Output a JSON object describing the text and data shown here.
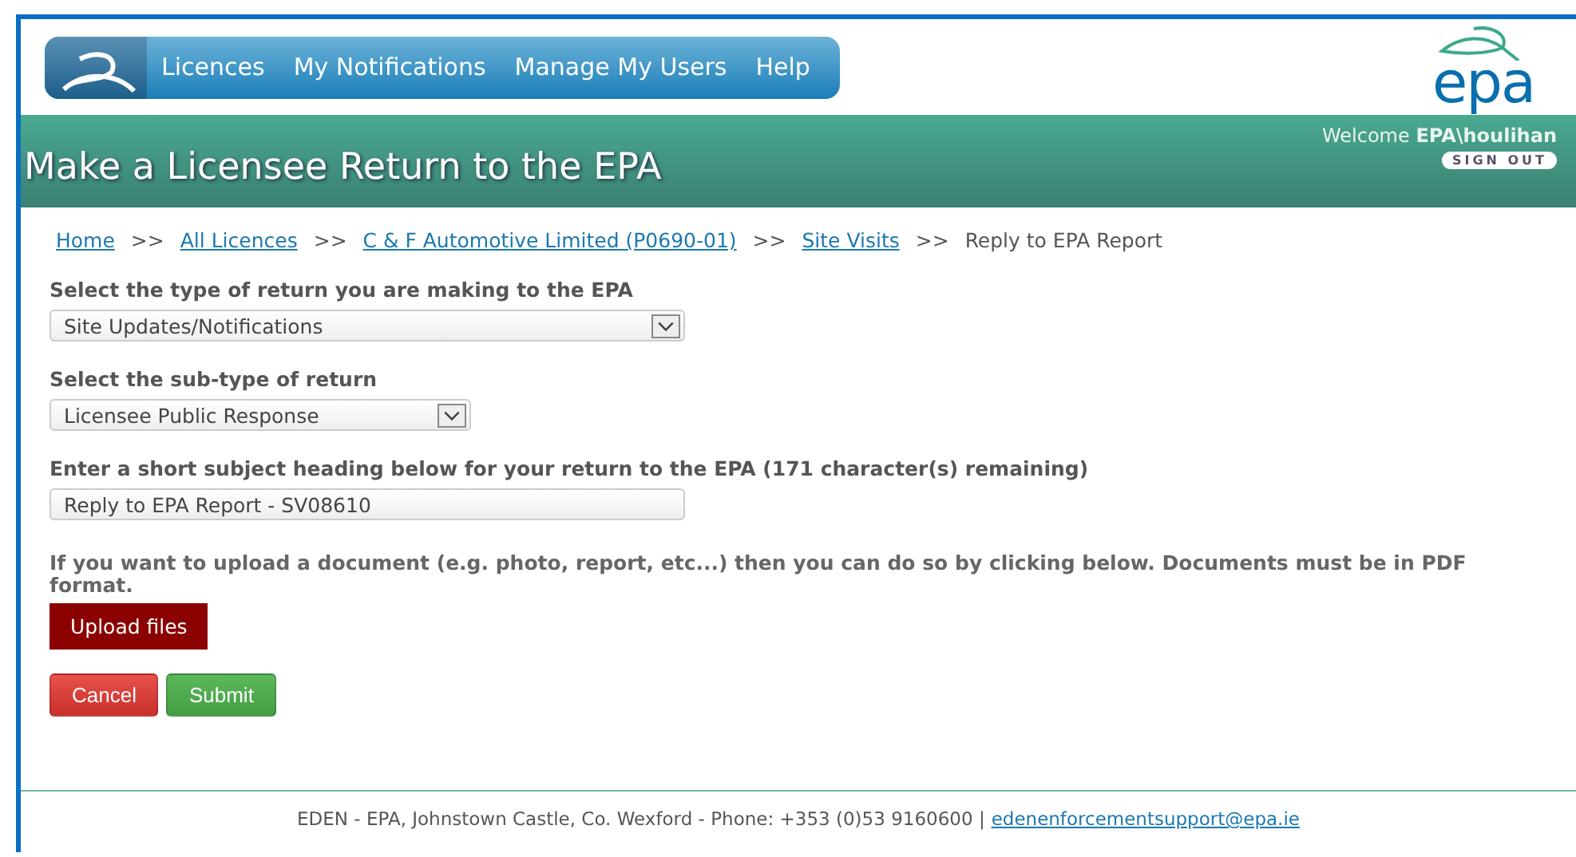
{
  "nav": {
    "items": [
      {
        "label": "Licences"
      },
      {
        "label": "My Notifications"
      },
      {
        "label": "Manage My Users"
      },
      {
        "label": "Help"
      }
    ]
  },
  "logo": {
    "text": "epa"
  },
  "banner": {
    "title": "Make a Licensee Return to the EPA",
    "welcome": "Welcome **EPA\\houlihan**",
    "sign_out": "SIGN OUT"
  },
  "breadcrumbs": [
    {
      "label": "Home",
      "link": true
    },
    {
      "label": "All Licences",
      "link": true
    },
    {
      "label": "C & F Automotive Limited (P0690-01)",
      "link": true
    },
    {
      "label": "Site Visits",
      "link": true
    },
    {
      "label": "Reply to EPA Report",
      "link": false
    }
  ],
  "breadcrumb_separator": ">>",
  "form": {
    "fields": [
      {
        "kind": "wide_select",
        "label": "Select the type of return you are making to the EPA",
        "value": "Site Updates/Notifications"
      },
      {
        "kind": "narrow_select",
        "label": "Select the sub-type of return",
        "value": "Licensee Public Response"
      },
      {
        "kind": "text",
        "label": "Enter a short subject heading below for your return to the EPA (171 character(s) remaining)",
        "value": "Reply to EPA Report - SV08610"
      }
    ],
    "upload_note": "If you want to upload a document (e.g. photo, report, etc...) then you can do so by clicking below. Documents must be in PDF format.",
    "upload_button": "Upload files",
    "buttons": [
      {
        "label": "Cancel",
        "kind": "danger"
      },
      {
        "label": "Submit",
        "kind": "success"
      }
    ]
  },
  "footer": {
    "text": "EDEN - EPA, Johnstown Castle, Co. Wexford - Phone: +353 (0)53 9160600 |",
    "email": "edenenforcementsupport@epa.ie"
  }
}
